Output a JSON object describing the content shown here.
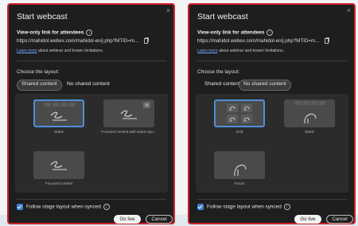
{
  "dialogs": [
    {
      "title": "Start webcast",
      "close_glyph": "×",
      "link_title": "View-only link for attendees",
      "info_glyph": "i",
      "url": "https://mahidol.webex.com/mahidol-en/j.php?MTID=m...",
      "learn_more_link": "Learn more",
      "learn_more_rest": " about webinar and known limitations.",
      "choose_layout": "Choose the layout:",
      "tabs": [
        "Shared content",
        "No shared content"
      ],
      "active_tab": "Shared content",
      "layouts": [
        {
          "label": "Stack",
          "selected": true,
          "icon": "signature-icon"
        },
        {
          "label": "Focused content with active spe...",
          "selected": false,
          "icon": "signature-with-speaker-icon"
        },
        {
          "label": "Focused content",
          "selected": false,
          "icon": "signature-icon"
        }
      ],
      "follow_label": "Follow stage layout when synced",
      "follow_checked": true,
      "go_live": "Go live",
      "cancel": "Cancel"
    },
    {
      "title": "Start webcast",
      "close_glyph": "×",
      "link_title": "View-only link for attendees",
      "info_glyph": "i",
      "url": "https://mahidol.webex.com/mahidol-en/j.php?MTID=m...",
      "learn_more_link": "Learn more",
      "learn_more_rest": " about webinar and known limitations.",
      "choose_layout": "Choose the layout:",
      "tabs": [
        "Shared content",
        "No shared content"
      ],
      "active_tab": "No shared content",
      "layouts": [
        {
          "label": "Grid",
          "selected": true,
          "icon": "grid-faces-icon"
        },
        {
          "label": "Stack",
          "selected": false,
          "icon": "face-stack-icon"
        },
        {
          "label": "Focus",
          "selected": false,
          "icon": "face-focus-icon"
        }
      ],
      "follow_label": "Follow stage layout when synced",
      "follow_checked": true,
      "go_live": "Go live",
      "cancel": "Cancel"
    }
  ],
  "colors": {
    "accent": "#4f8fd9",
    "border": "#d21f2a",
    "dialog_bg": "#1e1e1e"
  }
}
